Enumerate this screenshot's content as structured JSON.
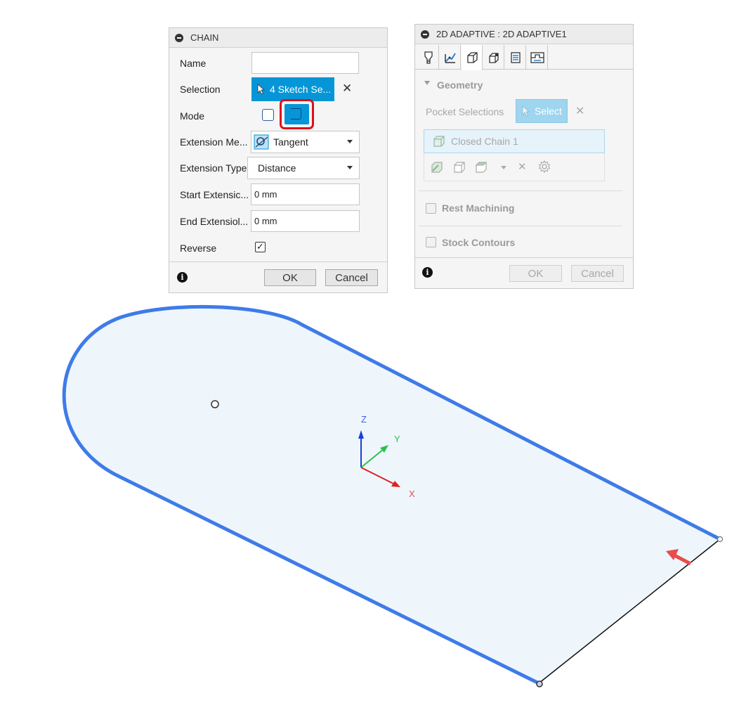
{
  "chain_panel": {
    "title": "CHAIN",
    "name_label": "Name",
    "name_value": "",
    "selection_label": "Selection",
    "selection_button": "4 Sketch Se...",
    "mode_label": "Mode",
    "extension_method_label": "Extension Me...",
    "extension_method_value": "Tangent",
    "extension_type_label": "Extension Type",
    "extension_type_value": "Distance",
    "start_extension_label": "Start Extensic...",
    "start_extension_value": "0 mm",
    "end_extension_label": "End Extensiol...",
    "end_extension_value": "0 mm",
    "reverse_label": "Reverse",
    "reverse_checked": "✓",
    "ok_label": "OK",
    "cancel_label": "Cancel",
    "selected_color": "#0696d7",
    "highlight_color": "#e0101a"
  },
  "adaptive_panel": {
    "title": "2D ADAPTIVE : 2D ADAPTIVE1",
    "geometry_label": "Geometry",
    "pocket_selections_label": "Pocket Selections",
    "select_button": "Select",
    "closed_chain_item": "Closed Chain 1",
    "rest_machining_label": "Rest Machining",
    "stock_contours_label": "Stock Contours",
    "ok_label": "OK",
    "cancel_label": "Cancel",
    "tabs": [
      "tool-icon",
      "heights-icon",
      "geometry-icon",
      "passes-icon",
      "linking-icon",
      "stock-icon"
    ]
  },
  "viewport": {
    "axis_x": "X",
    "axis_y": "Y",
    "axis_z": "Z",
    "outline_color": "#3f7be8",
    "fill_color": "#eef6fc",
    "direction_arrow_color": "#e84c4c"
  }
}
